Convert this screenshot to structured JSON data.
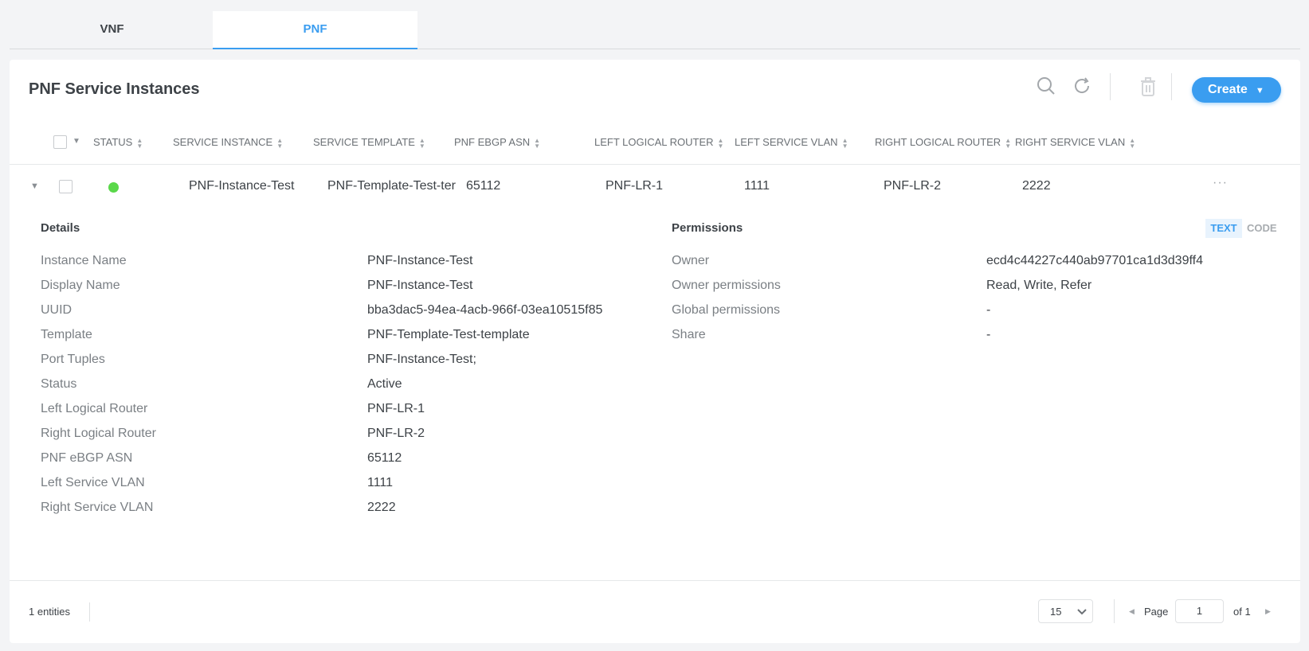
{
  "tabs": [
    {
      "label": "VNF",
      "active": false
    },
    {
      "label": "PNF",
      "active": true
    }
  ],
  "title": "PNF Service Instances",
  "toolbar": {
    "create_label": "Create",
    "icons": [
      "search-icon",
      "refresh-icon",
      "trash-icon"
    ]
  },
  "columns": [
    "STATUS",
    "SERVICE INSTANCE",
    "SERVICE TEMPLATE",
    "PNF EBGP ASN",
    "LEFT LOGICAL ROUTER",
    "LEFT SERVICE VLAN",
    "RIGHT LOGICAL ROUTER",
    "RIGHT SERVICE VLAN"
  ],
  "row": {
    "status_color": "#5ad84a",
    "instance": "PNF-Instance-Test",
    "template": "PNF-Template-Test-ter",
    "asn": "65112",
    "left_lr": "PNF-LR-1",
    "left_vlan": "1111",
    "right_lr": "PNF-LR-2",
    "right_vlan": "2222",
    "more": "···"
  },
  "details": {
    "heading": "Details",
    "items": [
      {
        "label": "Instance Name",
        "value": "PNF-Instance-Test"
      },
      {
        "label": "Display Name",
        "value": "PNF-Instance-Test"
      },
      {
        "label": "UUID",
        "value": "bba3dac5-94ea-4acb-966f-03ea10515f85"
      },
      {
        "label": "Template",
        "value": "PNF-Template-Test-template"
      },
      {
        "label": "Port Tuples",
        "value": "PNF-Instance-Test;"
      },
      {
        "label": "Status",
        "value": "Active"
      },
      {
        "label": "Left Logical Router",
        "value": "PNF-LR-1"
      },
      {
        "label": "Right Logical Router",
        "value": "PNF-LR-2"
      },
      {
        "label": "PNF eBGP ASN",
        "value": "65112"
      },
      {
        "label": "Left Service VLAN",
        "value": "1111"
      },
      {
        "label": "Right Service VLAN",
        "value": "2222"
      }
    ]
  },
  "permissions": {
    "heading": "Permissions",
    "view_text": "TEXT",
    "view_code": "CODE",
    "items": [
      {
        "label": "Owner",
        "value": "ecd4c44227c440ab97701ca1d3d39ff4"
      },
      {
        "label": "Owner permissions",
        "value": "Read, Write, Refer"
      },
      {
        "label": "Global permissions",
        "value": "-"
      },
      {
        "label": "Share",
        "value": "-"
      }
    ]
  },
  "footer": {
    "entities": "1 entities",
    "page_size": "15",
    "page_label": "Page",
    "page": "1",
    "of": "of 1"
  }
}
